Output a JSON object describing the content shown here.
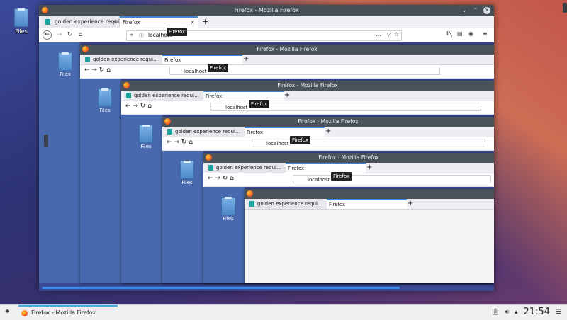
{
  "desktop": {
    "icon_label": "Files"
  },
  "window": {
    "title": "Firefox - Mozilla Firefox",
    "tabs": [
      {
        "label": "golden experience requi…",
        "active": false
      },
      {
        "label": "Firefox",
        "active": true
      }
    ],
    "url": "localhost",
    "tooltip": "Firefox",
    "page_actions": "…"
  },
  "nested": {
    "title": "Firefox - Mozilla Firefox",
    "tab1": "golden experience requi…",
    "tab2": "Firefox",
    "url": "localhost",
    "tooltip": "Firefox",
    "icon_label": "Files"
  },
  "taskbar": {
    "task_label": "Firefox - Mozilla Firefox",
    "clock": "21:54"
  },
  "colors": {
    "accent": "#3daee9",
    "titlebar": "#475057"
  }
}
